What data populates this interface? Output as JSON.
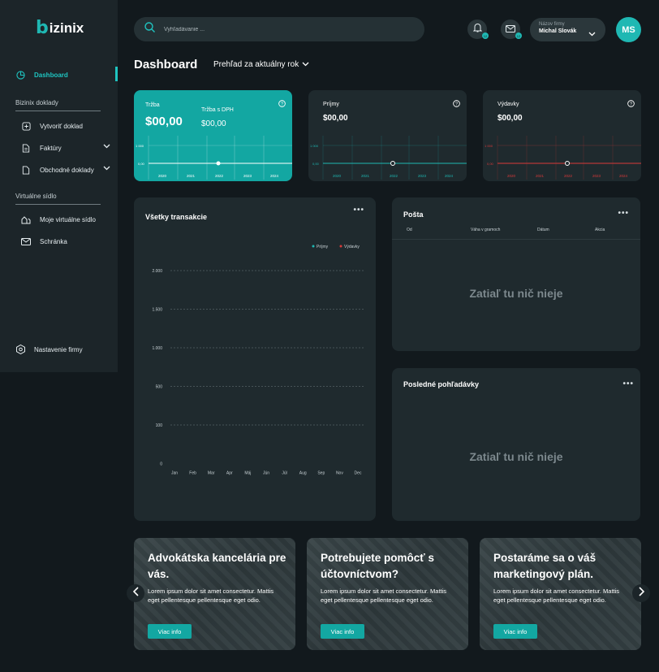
{
  "brand": {
    "name": "izinix",
    "mark": "b"
  },
  "sidebar": {
    "dashboard": "Dashboard",
    "section1": "Bizinix doklady",
    "create": "Vytvoriť doklad",
    "invoices": "Faktúry",
    "business_docs": "Obchodné doklady",
    "section2": "Virtuálne sídlo",
    "my_virtual": "Moje virtuálne sídlo",
    "mailbox": "Schránka",
    "settings": "Nastavenie firmy"
  },
  "search": {
    "placeholder": "Vyhľadávanie ..."
  },
  "notifications": {
    "bell_count": "12",
    "mail_count": "12"
  },
  "company": {
    "label": "Názov firmy",
    "user": "Michal Slovák"
  },
  "avatar": "MS",
  "header": {
    "title": "Dashboard",
    "period_label": "Prehľad za  aktuálny rok"
  },
  "kpis": {
    "revenue": {
      "title": "Tržba",
      "value": "$00,00",
      "vat_title": "Tržba s DPH",
      "vat_value": "$00,00"
    },
    "income": {
      "title": "Príjmy",
      "value": "$00,00"
    },
    "expenses": {
      "title": "Výdavky",
      "value": "$00,00"
    },
    "mini_y": [
      "1 000",
      "0,00"
    ],
    "mini_x": [
      "2020",
      "2021",
      "2022",
      "2023",
      "2024"
    ]
  },
  "transactions": {
    "title": "Všetky transakcie",
    "legend_income": "Príjmy",
    "legend_expense": "Výdavky",
    "y_ticks": [
      "2.000",
      "1.500",
      "1.000",
      "500",
      "100",
      "0"
    ],
    "months": [
      "Jan",
      "Feb",
      "Mar",
      "Apr",
      "Máj",
      "Jún",
      "Júl",
      "Aug",
      "Sep",
      "Nov",
      "Dec"
    ]
  },
  "mail": {
    "title": "Pošta",
    "cols": [
      "Od",
      "Váha v gramoch",
      "Dátum",
      "Akcia"
    ],
    "empty": "Zatiaľ tu nič nieje"
  },
  "receivables": {
    "title": "Posledné pohľadávky",
    "empty": "Zatiaľ tu nič nieje"
  },
  "promos": [
    {
      "title": "Advokátska kancelária pre vás.",
      "body": "Lorem ipsum dolor sit amet consectetur. Mattis eget pellentesque pellentesque eget odio.",
      "button": "Viac info"
    },
    {
      "title": "Potrebujete pomôcť s účtovníctvom?",
      "body": "Lorem ipsum dolor sit amet consectetur. Mattis eget pellentesque pellentesque eget odio.",
      "button": "Viac info"
    },
    {
      "title": "Postaráme sa o váš marketingový plán.",
      "body": "Lorem ipsum dolor sit amet consectetur. Mattis eget pellentesque pellentesque eget odio.",
      "button": "Viac info"
    }
  ],
  "colors": {
    "accent": "#13a7a2",
    "income": "#1fb8b3",
    "expense": "#d83a3a",
    "sidebar": "#1c2529",
    "panel": "#1f2a2e"
  }
}
